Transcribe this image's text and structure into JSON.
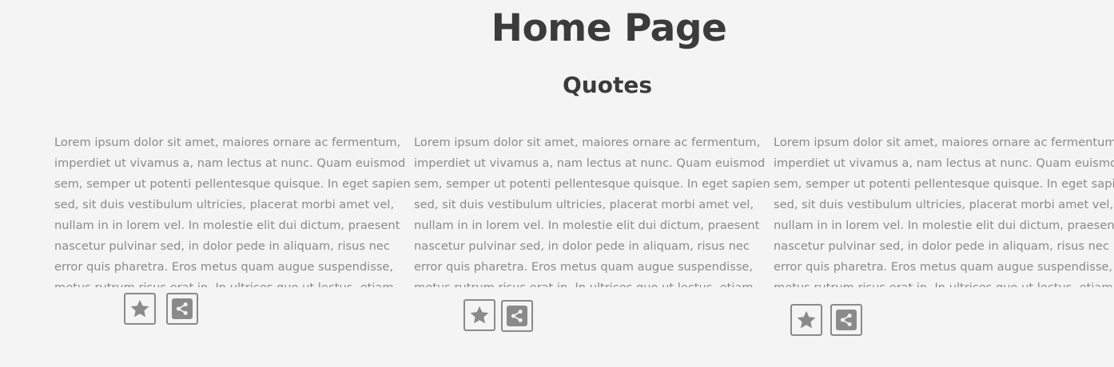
{
  "header": {
    "title": "Home Page"
  },
  "section": {
    "title": "Quotes"
  },
  "quotes": [
    {
      "text": "Lorem ipsum dolor sit amet, maiores ornare ac fermentum, imperdiet ut vivamus a, nam lectus at nunc. Quam euismod sem, semper ut potenti pellentesque quisque. In eget sapien sed, sit duis vestibulum ultricies, placerat morbi amet vel, nullam in in lorem vel. In molestie elit dui dictum, praesent nascetur pulvinar sed, in dolor pede in aliquam, risus nec error quis pharetra. Eros metus quam augue suspendisse, metus rutrum risus erat in.  In ultrices quo ut lectus, etiam",
      "favorite_icon": "star-icon",
      "share_icon": "share-icon"
    },
    {
      "text": "Lorem ipsum dolor sit amet, maiores ornare ac fermentum, imperdiet ut vivamus a, nam lectus at nunc. Quam euismod sem, semper ut potenti pellentesque quisque. In eget sapien sed, sit duis vestibulum ultricies, placerat morbi amet vel, nullam in in lorem vel. In molestie elit dui dictum, praesent nascetur pulvinar sed, in dolor pede in aliquam, risus nec error quis pharetra. Eros metus quam augue suspendisse, metus rutrum risus erat in.  In ultrices quo ut lectus, etiam",
      "favorite_icon": "star-icon",
      "share_icon": "share-icon"
    },
    {
      "text": "Lorem ipsum dolor sit amet, maiores ornare ac fermentum, imperdiet ut vivamus a, nam lectus at nunc. Quam euismod sem, semper ut potenti pellentesque quisque. In eget sapien sed, sit duis vestibulum ultricies, placerat morbi amet vel, nullam in in lorem vel. In molestie elit dui dictum, praesent nascetur pulvinar sed, in dolor pede in aliquam, risus nec error quis pharetra. Eros metus quam augue suspendisse, metus rutrum risus erat in.  In ultrices quo ut lectus, etiam",
      "favorite_icon": "star-icon",
      "share_icon": "share-icon"
    }
  ],
  "colors": {
    "background": "#f4f4f4",
    "heading": "#3b3b3b",
    "body_text": "#8a8a8a",
    "icon": "#8a8a8a"
  }
}
